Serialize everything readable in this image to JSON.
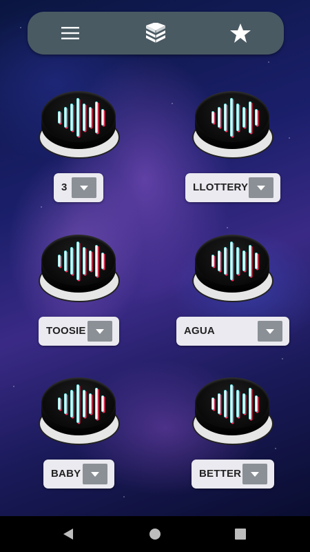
{
  "toolbar": {
    "menu_icon": "menu-icon",
    "book_icon": "book-stack-icon",
    "star_icon": "star-icon"
  },
  "buttons": [
    {
      "icon": "sound-wave-icon",
      "dropdown": {
        "selected": "3"
      }
    },
    {
      "icon": "sound-wave-icon",
      "dropdown": {
        "selected": "LLOTTERY"
      }
    },
    {
      "icon": "sound-wave-icon",
      "dropdown": {
        "selected": "TOOSIE"
      }
    },
    {
      "icon": "sound-wave-icon",
      "dropdown": {
        "selected": "AGUA"
      }
    },
    {
      "icon": "sound-wave-icon",
      "dropdown": {
        "selected": "BABY"
      }
    },
    {
      "icon": "sound-wave-icon",
      "dropdown": {
        "selected": "BETTER"
      }
    }
  ],
  "navbar": {
    "back_icon": "back-triangle-icon",
    "home_icon": "home-circle-icon",
    "recents_icon": "recents-square-icon"
  },
  "colors": {
    "toolbar_bg": "#4a5a63",
    "wave_cyan": "#39e0e0",
    "wave_red": "#ff2a55",
    "dropdown_bg": "#eaeaf0",
    "dropdown_arrow_bg": "#8a9095"
  }
}
